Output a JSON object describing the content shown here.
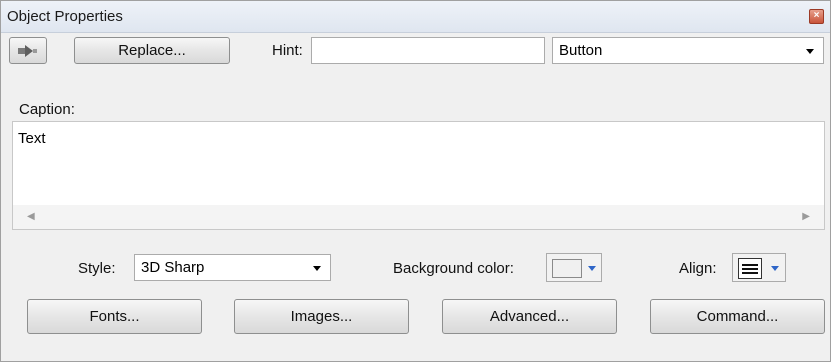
{
  "window": {
    "title": "Object Properties",
    "close_icon": "close-icon"
  },
  "toolbar": {
    "replace_label": "Replace...",
    "hint_label": "Hint:",
    "hint_value": "",
    "type_selected": "Button"
  },
  "caption": {
    "label": "Caption:",
    "value": "Text"
  },
  "style_row": {
    "style_label": "Style:",
    "style_selected": "3D Sharp",
    "bg_label": "Background color:",
    "bg_swatch_color": "#f0f0f0",
    "align_label": "Align:"
  },
  "buttons": {
    "fonts": "Fonts...",
    "images": "Images...",
    "advanced": "Advanced...",
    "command": "Command..."
  }
}
